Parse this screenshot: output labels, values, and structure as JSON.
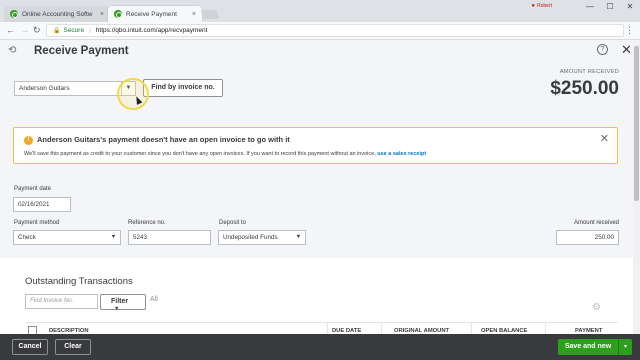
{
  "browser": {
    "tabs": [
      {
        "title": "Online Accounting Softw",
        "close": "×"
      },
      {
        "title": "Receive Payment",
        "close": "×"
      }
    ],
    "user": "Robert",
    "window_controls": [
      "—",
      "☐",
      "✕"
    ],
    "secure_label": "Secure",
    "url": "https://qbo.intuit.com/app/recvpayment"
  },
  "header": {
    "title": "Receive Payment",
    "help": "?",
    "close": "✕"
  },
  "customer": {
    "value": "Anderson Guitars",
    "find_button": "Find by invoice no."
  },
  "amount": {
    "label": "AMOUNT RECEIVED",
    "value": "$250.00"
  },
  "alert": {
    "icon": "!",
    "title": "Anderson Guitars's payment doesn't have an open invoice to go with it",
    "body": "We'll save this payment as credit to your customer since you don't have any open invoices. If you want to record this payment without an invoice, ",
    "link": "use a sales receipt",
    "close": "✕"
  },
  "form": {
    "payment_date_label": "Payment date",
    "payment_date": "02/16/2021",
    "payment_method_label": "Payment method",
    "payment_method": "Check",
    "reference_label": "Reference no.",
    "reference": "5243",
    "deposit_label": "Deposit to",
    "deposit": "Undeposited Funds",
    "amount_label": "Amount received",
    "amount": "250.00"
  },
  "outstanding": {
    "title": "Outstanding Transactions",
    "find_placeholder": "Find Invoice No.",
    "filter": "Filter",
    "all": "All",
    "columns": [
      "DESCRIPTION",
      "DUE DATE",
      "ORIGINAL AMOUNT",
      "OPEN BALANCE",
      "PAYMENT"
    ]
  },
  "footer": {
    "cancel": "Cancel",
    "clear": "Clear",
    "save_new": "Save and new",
    "save_dd": "▾"
  },
  "icons": {
    "history": "history-icon",
    "gear": "gear-icon"
  }
}
